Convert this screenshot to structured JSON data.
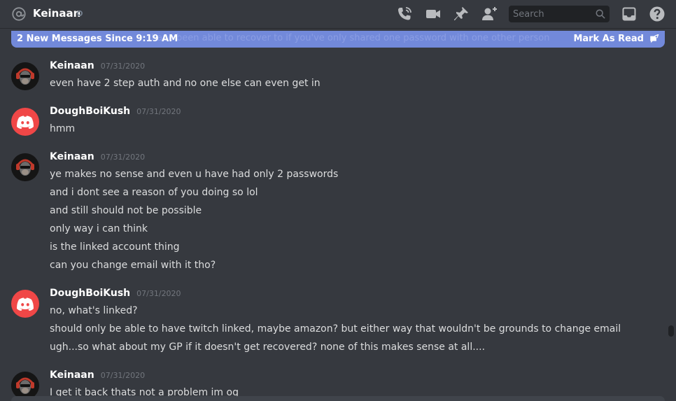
{
  "header": {
    "title": "Keinaan",
    "search_placeholder": "Search"
  },
  "banner": {
    "text": "2 New Messages Since 9:19 AM",
    "ghost_text": "have been able to recover to if you've only shared one password with one other person",
    "mark_read_label": "Mark As Read"
  },
  "messages": [
    {
      "author": "Keinaan",
      "timestamp": "07/31/2020",
      "lines": [
        "even have 2 step auth and no one else can even get in"
      ]
    },
    {
      "author": "DoughBoiKush",
      "timestamp": "07/31/2020",
      "lines": [
        "hmm"
      ]
    },
    {
      "author": "Keinaan",
      "timestamp": "07/31/2020",
      "lines": [
        "ye makes no sense and even u have had only 2 passwords",
        "and i dont see a reason of you doing so lol",
        "and still should not be possible",
        "only way i can think",
        "is the linked account thing",
        "can you change email with it tho?"
      ]
    },
    {
      "author": "DoughBoiKush",
      "timestamp": "07/31/2020",
      "lines": [
        "no, what's linked?",
        "should only be able to have twitch linked, maybe amazon? but either way that wouldn't be grounds to change email",
        "ugh...so what about my GP if it doesn't get recovered? none of this makes sense at all...."
      ]
    },
    {
      "author": "Keinaan",
      "timestamp": "07/31/2020",
      "lines": [
        "I get it back thats not a problem im og"
      ]
    }
  ],
  "icons": {
    "mention": "at-icon",
    "status": "offline-status-icon",
    "call": "phone-call-icon",
    "video": "video-camera-icon",
    "pin": "pin-icon",
    "add_user": "add-friend-icon",
    "search": "search-icon",
    "inbox": "inbox-icon",
    "help": "help-icon",
    "mark_read": "mark-read-icon"
  },
  "colors": {
    "background": "#36393f",
    "banner": "#7289da",
    "discord_red": "#f04747",
    "text": "#dcddde",
    "muted": "#72767d"
  }
}
